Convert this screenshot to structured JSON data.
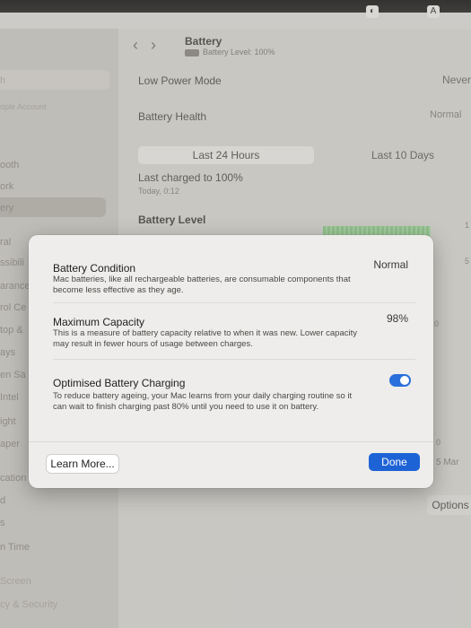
{
  "window": {
    "title": "Battery",
    "subtitle": "Battery Level: 100%"
  },
  "sidebar": {
    "items": [
      {
        "label": "h",
        "style": "faint"
      },
      {
        "label": "ople Account",
        "style": "faint"
      },
      {
        "label": "ooth",
        "style": "normal"
      },
      {
        "label": "ork",
        "style": "normal"
      },
      {
        "label": "ery",
        "style": "normal"
      },
      {
        "label": "ral",
        "style": "normal"
      },
      {
        "label": "ssibili",
        "style": "normal"
      },
      {
        "label": "arance",
        "style": "normal"
      },
      {
        "label": "rol Ce",
        "style": "normal"
      },
      {
        "label": "top &",
        "style": "normal"
      },
      {
        "label": "ays",
        "style": "normal"
      },
      {
        "label": "en Sa",
        "style": "normal"
      },
      {
        "label": "Intel",
        "style": "normal"
      },
      {
        "label": "ight",
        "style": "normal"
      },
      {
        "label": "aper",
        "style": "normal"
      },
      {
        "label": "cation",
        "style": "normal"
      },
      {
        "label": "d",
        "style": "normal"
      },
      {
        "label": "s",
        "style": "normal"
      },
      {
        "label": "n Time",
        "style": "normal"
      },
      {
        "label": "Screen",
        "style": "faint"
      },
      {
        "label": "cy & Security",
        "style": "faint"
      }
    ]
  },
  "main": {
    "low_power_label": "Low Power Mode",
    "low_power_value": "Never",
    "health_label": "Battery Health",
    "health_value": "Normal",
    "tab_24h": "Last 24 Hours",
    "tab_10d": "Last 10 Days",
    "last_charged": "Last charged to 100%",
    "last_charged_time": "Today, 0:12",
    "level_heading": "Battery Level",
    "edge_numbers": [
      "1",
      "5",
      "0",
      "0"
    ],
    "edge_date": "5 Mar",
    "options_label": "Options"
  },
  "dialog": {
    "condition_title": "Battery Condition",
    "condition_desc": "Mac batteries, like all rechargeable batteries, are consumable components that become less effective as they age.",
    "condition_value": "Normal",
    "capacity_title": "Maximum Capacity",
    "capacity_desc": "This is a measure of battery capacity relative to when it was new. Lower capacity may result in fewer hours of usage between charges.",
    "capacity_value": "98%",
    "optimised_title": "Optimised Battery Charging",
    "optimised_desc": "To reduce battery ageing, your Mac learns from your daily charging routine so it can wait to finish charging past 80% until you need to use it on battery.",
    "optimised_enabled": true,
    "learn_more_label": "Learn More...",
    "done_label": "Done"
  },
  "menubar": {
    "icons": [
      "app-icon",
      "input-source-icon"
    ],
    "input_label": "A"
  },
  "colors": {
    "accent": "#1e63d6",
    "toggle_on": "#2a6fdb"
  }
}
